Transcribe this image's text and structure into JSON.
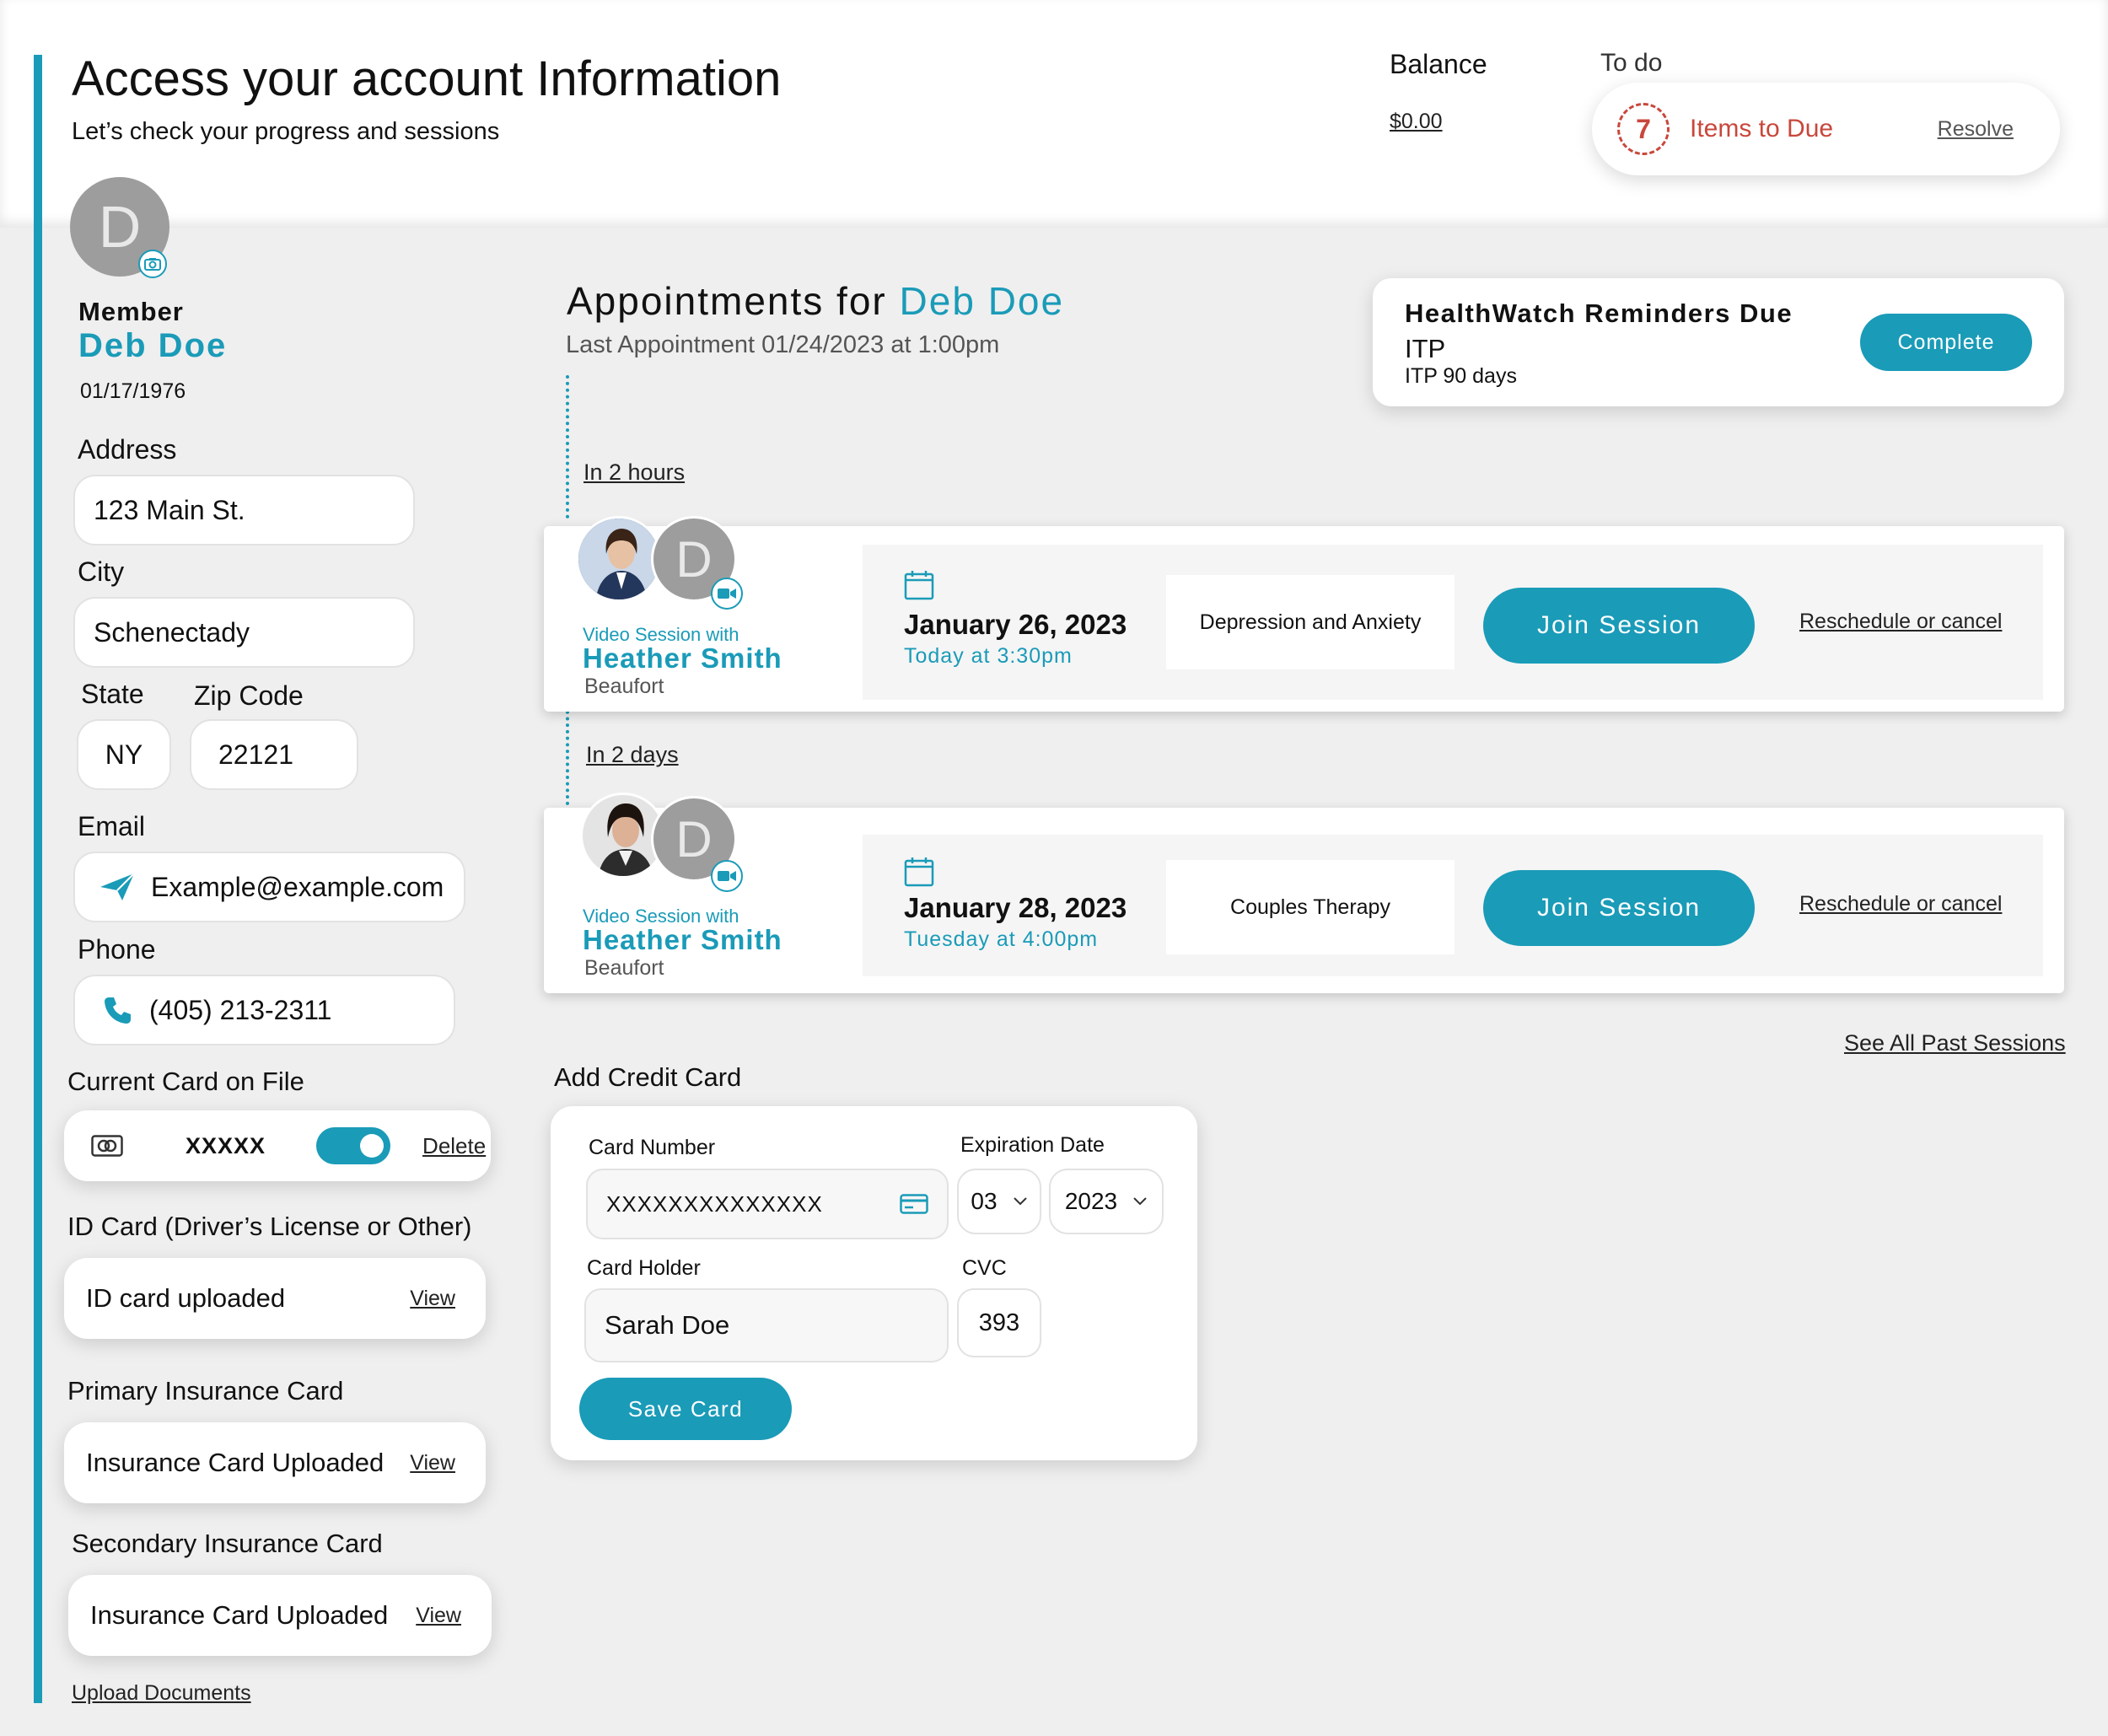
{
  "header": {
    "title": "Access your account Information",
    "subtitle": "Let’s check your progress and sessions"
  },
  "balance": {
    "label": "Balance",
    "amount": "$0.00"
  },
  "todo": {
    "label": "To do",
    "count": "7",
    "text": "Items to Due",
    "action": "Resolve"
  },
  "member": {
    "initial": "D",
    "role": "Member",
    "name": "Deb Doe",
    "dob": "01/17/1976",
    "address_label": "Address",
    "address": "123 Main St.",
    "city_label": "City",
    "city": "Schenectady",
    "state_label": "State",
    "state": "NY",
    "zip_label": "Zip Code",
    "zip": "22121",
    "email_label": "Email",
    "email": "Example@example.com",
    "phone_label": "Phone",
    "phone": "(405) 213-2311"
  },
  "card_on_file": {
    "label": "Current Card on File",
    "number": "XXXXX",
    "delete": "Delete"
  },
  "id_card": {
    "label": "ID Card (Driver’s License or Other)",
    "status": "ID card uploaded",
    "view": "View"
  },
  "primary_ins": {
    "label": "Primary Insurance Card",
    "status": "Insurance Card Uploaded",
    "view": "View"
  },
  "secondary_ins": {
    "label": "Secondary Insurance Card",
    "status": "Insurance Card Uploaded",
    "view": "View"
  },
  "upload_docs": "Upload Documents",
  "appointments": {
    "title_prefix": "Appointments for",
    "title_name": "Deb Doe",
    "last": "Last Appointment 01/24/2023 at 1:00pm",
    "see_all": "See All Past Sessions",
    "items": [
      {
        "when": "In 2 hours",
        "with_label": "Video Session with",
        "provider": "Heather Smith",
        "location": "Beaufort",
        "date": "January 26, 2023",
        "time": "Today at 3:30pm",
        "topic": "Depression and Anxiety",
        "join": "Join Session",
        "reschedule": "Reschedule or cancel",
        "initial": "D"
      },
      {
        "when": "In 2 days",
        "with_label": "Video Session with",
        "provider": "Heather Smith",
        "location": "Beaufort",
        "date": "January 28, 2023",
        "time": "Tuesday at 4:00pm",
        "topic": "Couples Therapy",
        "join": "Join Session",
        "reschedule": "Reschedule or cancel",
        "initial": "D"
      }
    ]
  },
  "reminders": {
    "title": "HealthWatch Reminders Due",
    "item": "ITP",
    "detail": "ITP 90 days",
    "action": "Complete"
  },
  "credit_card": {
    "title": "Add Credit Card",
    "number_label": "Card Number",
    "number": "XXXXXXXXXXXXXX",
    "exp_label": "Expiration Date",
    "month": "03",
    "year": "2023",
    "holder_label": "Card Holder",
    "holder": "Sarah Doe",
    "cvc_label": "CVC",
    "cvc": "393",
    "save": "Save Card"
  },
  "colors": {
    "accent": "#1a9bb8",
    "alert": "#c8473b",
    "avatar_gray": "#9d9d9d"
  }
}
